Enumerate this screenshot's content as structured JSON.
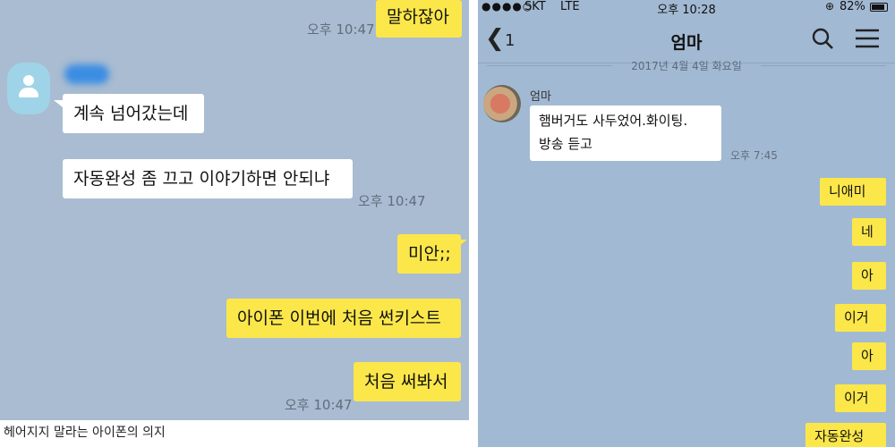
{
  "left_chat": {
    "messages": [
      {
        "side": "out",
        "text": "말하잖아"
      },
      {
        "side": "in",
        "text": "계속 넘어갔는데"
      },
      {
        "side": "in",
        "text": "자동완성 좀 끄고 이야기하면 안되냐"
      },
      {
        "side": "out",
        "text": "미안;;"
      },
      {
        "side": "out",
        "text": "아이폰 이번에 처음 썬키스트"
      },
      {
        "side": "out",
        "text": "처음 써봐서"
      }
    ],
    "timestamps": [
      "오후 10:47",
      "오후 10:47",
      "오후 10:47"
    ]
  },
  "caption": "헤어지지 말라는 아이폰의 의지",
  "right_chat": {
    "status": {
      "carrier": "SKT",
      "network": "LTE",
      "time": "오후 10:28",
      "battery": "82%"
    },
    "nav": {
      "back_count": "1",
      "title": "엄마"
    },
    "date_divider": "2017년 4월 4일 화요일",
    "sender_name": "엄마",
    "incoming": {
      "line1": "햄버거도 사두었어.화이팅.",
      "line2": "방송 듣고",
      "time": "오후 7:45"
    },
    "replies": [
      "니애미",
      "네",
      "아",
      "이거",
      "아",
      "이거",
      "자동완성"
    ]
  },
  "colors": {
    "left_bg": "#a9bcd1",
    "right_bg": "#a2b9d3",
    "my_bubble": "#fbe74a",
    "their_bubble": "#ffffff"
  }
}
